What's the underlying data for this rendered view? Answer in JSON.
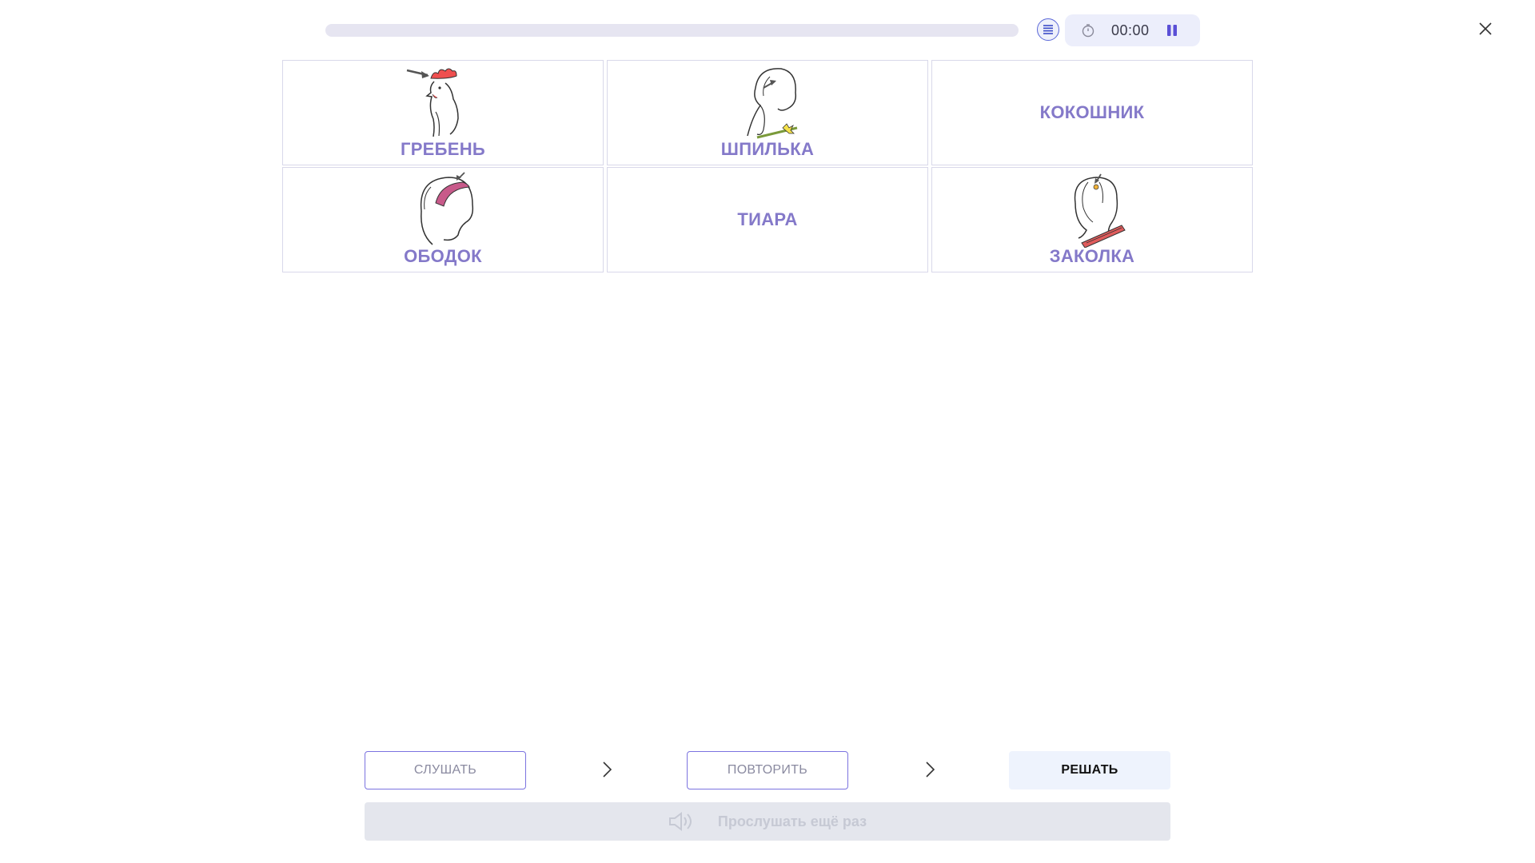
{
  "header": {
    "progress_percent": 0,
    "timer": "00:00"
  },
  "cards": [
    {
      "label": "ГРЕБЕНЬ",
      "icon": "rooster-comb-icon"
    },
    {
      "label": "ШПИЛЬКА",
      "icon": "hairpin-icon"
    },
    {
      "label": "КОКОШНИК",
      "icon": null
    },
    {
      "label": "ОБОДОК",
      "icon": "headband-icon"
    },
    {
      "label": "ТИАРА",
      "icon": null
    },
    {
      "label": "ЗАКОЛКА",
      "icon": "hair-clip-icon"
    }
  ],
  "steps": {
    "listen": "СЛУШАТЬ",
    "repeat": "ПОВТОРИТЬ",
    "solve": "РЕШАТЬ"
  },
  "listen_again": {
    "label": "Прослушать ещё раз",
    "enabled": false
  },
  "colors": {
    "accent": "#8479c9",
    "button_border": "#7b73e0",
    "timer_bg": "#eceefb"
  }
}
